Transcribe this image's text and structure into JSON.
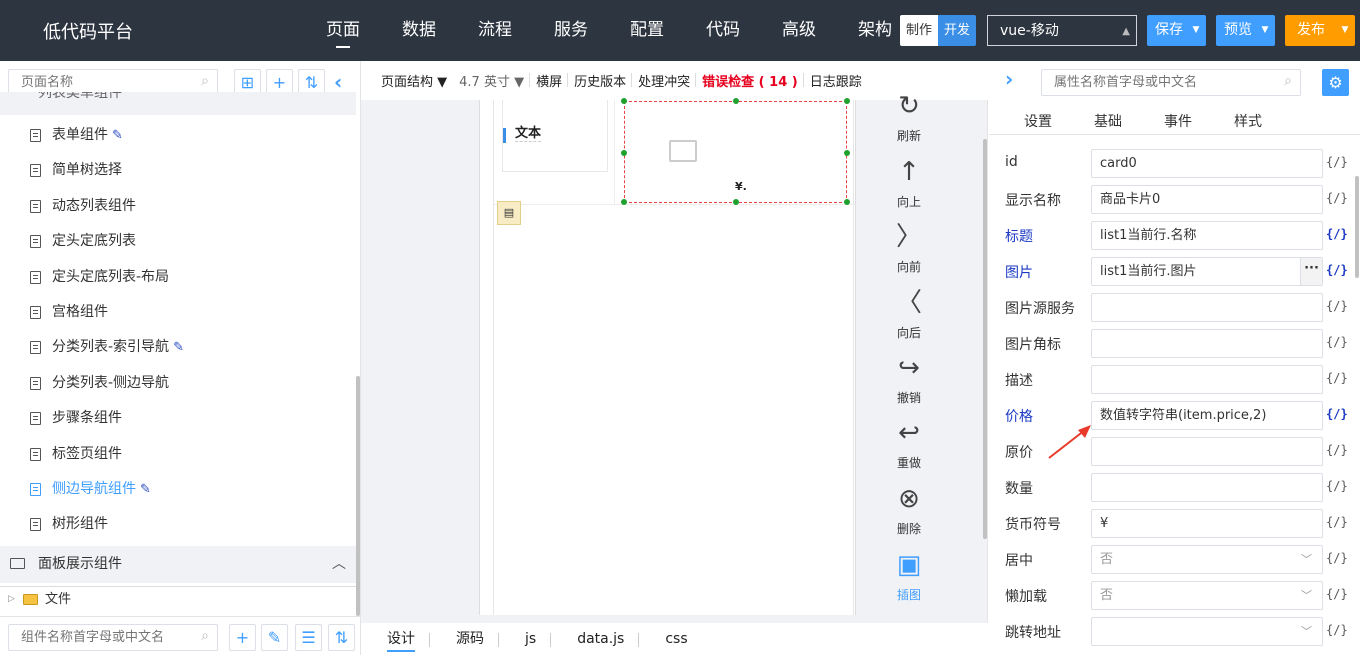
{
  "app": {
    "title": "低代码平台"
  },
  "nav": [
    "页面",
    "数据",
    "流程",
    "服务",
    "配置",
    "代码",
    "高级",
    "架构"
  ],
  "mode": {
    "make": "制作",
    "dev": "开发"
  },
  "platform": "vue-移动",
  "buttons": {
    "save": "保存",
    "preview": "预览",
    "publish": "发布"
  },
  "left": {
    "page_search_placeholder": "页面名称",
    "group_cut_label": "列表类单组件",
    "items": [
      {
        "label": "表单组件",
        "edit": true,
        "active": false
      },
      {
        "label": "简单树选择",
        "edit": false,
        "active": false
      },
      {
        "label": "动态列表组件",
        "edit": false,
        "active": false
      },
      {
        "label": "定头定底列表",
        "edit": false,
        "active": false
      },
      {
        "label": "定头定底列表-布局",
        "edit": false,
        "active": false
      },
      {
        "label": "宫格组件",
        "edit": false,
        "active": false
      },
      {
        "label": "分类列表-索引导航",
        "edit": true,
        "active": false
      },
      {
        "label": "分类列表-侧边导航",
        "edit": false,
        "active": false
      },
      {
        "label": "步骤条组件",
        "edit": false,
        "active": false
      },
      {
        "label": "标签页组件",
        "edit": false,
        "active": false
      },
      {
        "label": "侧边导航组件",
        "edit": true,
        "active": true
      },
      {
        "label": "树形组件",
        "edit": false,
        "active": false
      }
    ],
    "panel_group": "面板展示组件",
    "file_row": "文件",
    "component_search_placeholder": "组件名称首字母或中文名"
  },
  "toolbar": {
    "page_structure": "页面结构",
    "size": "4.7 英寸",
    "landscape": "横屏",
    "history": "历史版本",
    "conflict": "处理冲突",
    "error_check": "错误检查 ( 14 )",
    "log": "日志跟踪"
  },
  "canvas": {
    "text_label": "文本",
    "price_symbol": "¥."
  },
  "actions": [
    "刷新",
    "向上",
    "向前",
    "向后",
    "撤销",
    "重做",
    "删除",
    "插图"
  ],
  "bottom_tabs": [
    "设计",
    "源码",
    "js",
    "data.js",
    "css"
  ],
  "right": {
    "search_placeholder": "属性名称首字母或中文名",
    "tabs": [
      "设置",
      "基础",
      "事件",
      "样式"
    ],
    "code_tag": "{/}",
    "props": [
      {
        "label": "id",
        "value": "card0",
        "bound": false,
        "type": "input"
      },
      {
        "label": "显示名称",
        "value": "商品卡片0",
        "bound": false,
        "type": "input"
      },
      {
        "label": "标题",
        "value": "list1当前行.名称",
        "bound": true,
        "type": "input"
      },
      {
        "label": "图片",
        "value": "list1当前行.图片",
        "bound": true,
        "type": "input",
        "more": "···"
      },
      {
        "label": "图片源服务",
        "value": "",
        "bound": false,
        "type": "input"
      },
      {
        "label": "图片角标",
        "value": "",
        "bound": false,
        "type": "input"
      },
      {
        "label": "描述",
        "value": "",
        "bound": false,
        "type": "input"
      },
      {
        "label": "价格",
        "value": "数值转字符串(item.price,2)",
        "bound": true,
        "type": "input"
      },
      {
        "label": "原价",
        "value": "",
        "bound": false,
        "type": "input"
      },
      {
        "label": "数量",
        "value": "",
        "bound": false,
        "type": "input"
      },
      {
        "label": "货币符号",
        "value": "¥",
        "bound": false,
        "type": "input"
      },
      {
        "label": "居中",
        "value": "否",
        "bound": false,
        "type": "select"
      },
      {
        "label": "懒加载",
        "value": "否",
        "bound": false,
        "type": "select"
      },
      {
        "label": "跳转地址",
        "value": "",
        "bound": false,
        "type": "select"
      }
    ]
  },
  "colors": {
    "topbar": "#2d3540",
    "accent": "#409eff",
    "publish": "#ff9c00",
    "error": "#e6001e",
    "bound_label": "#1b39c4"
  }
}
